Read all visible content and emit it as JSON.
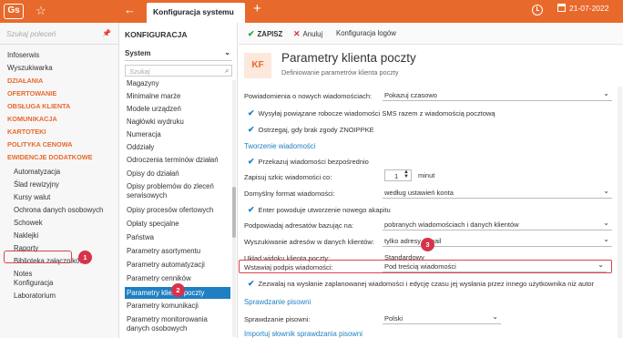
{
  "topbar": {
    "logo": "Gs",
    "tab_title": "Konfiguracja systemu",
    "date": "21-07-2022",
    "accent": "#e8692c"
  },
  "left_nav": {
    "search_placeholder": "Szukaj poleceń",
    "items": [
      {
        "label": "Infoserwis",
        "type": "plain"
      },
      {
        "label": "Wyszukiwarka",
        "type": "plain"
      },
      {
        "label": "DZIAŁANIA",
        "type": "group"
      },
      {
        "label": "OFERTOWANIE",
        "type": "group"
      },
      {
        "label": "OBSŁUGA KLIENTA",
        "type": "group"
      },
      {
        "label": "KOMUNIKACJA",
        "type": "group"
      },
      {
        "label": "KARTOTEKI",
        "type": "group"
      },
      {
        "label": "POLITYKA CENOWA",
        "type": "group"
      },
      {
        "label": "EWIDENCJE DODATKOWE",
        "type": "group"
      },
      {
        "label": "Automatyzacja",
        "type": "sub"
      },
      {
        "label": "Ślad rewizyjny",
        "type": "sub"
      },
      {
        "label": "Kursy walut",
        "type": "sub"
      },
      {
        "label": "Ochrona danych osobowych",
        "type": "sub"
      },
      {
        "label": "Schowek",
        "type": "sub"
      },
      {
        "label": "Naklejki",
        "type": "sub"
      },
      {
        "label": "Raporty",
        "type": "sub"
      },
      {
        "label": "Biblioteka załączników",
        "type": "sub"
      },
      {
        "label": "Notes",
        "type": "sub"
      },
      {
        "label": "Konfiguracja",
        "type": "sub"
      },
      {
        "label": "Laboratorium",
        "type": "sub"
      }
    ]
  },
  "middle": {
    "title": "KONFIGURACJA",
    "select_value": "System",
    "search_placeholder": "Szukaj",
    "items": [
      "Magazyny",
      "Minimalne marże",
      "Modele urządzeń",
      "Nagłówki wydruku",
      "Numeracja",
      "Oddziały",
      "Odroczenia terminów działań",
      "Opisy do działań",
      "Opisy problemów do zleceń serwisowych",
      "Opisy procesów ofertowych",
      "Opłaty specjalne",
      "Państwa",
      "Parametry asortymentu",
      "Parametry automatyzacji",
      "Parametry cenników",
      "Parametry działań",
      "Parametry klienta poczty",
      "Parametry komunikacji",
      "Parametry monitorowania danych osobowych"
    ]
  },
  "toolbar": {
    "save": "ZAPISZ",
    "cancel": "Anuluj",
    "logs": "Konfiguracja logów"
  },
  "page": {
    "icon_text": "KF",
    "title": "Parametry klienta poczty",
    "subtitle": "Definiowanie parametrów klienta poczty"
  },
  "form": {
    "notify_label": "Powiadomienia o nowych wiadomościach:",
    "notify_value": "Pokazuj czasowo",
    "check_sms": "Wysyłaj powiązane robocze wiadomości SMS razem z wiadomością pocztową",
    "check_warn": "Ostrzegaj, gdy brak zgody ZNOIPPKE",
    "section_create": "Tworzenie wiadomości",
    "check_forward": "Przekazuj wiadomości bezpośrednio",
    "draft_label": "Zapisuj szkic wiadomości co:",
    "draft_value": "1",
    "draft_unit": "minut",
    "format_label": "Domyślny format wiadomości:",
    "format_value": "według ustawień konta",
    "check_enter": "Enter powoduje utworzenie nowego akapitu",
    "suggest_label": "Podpowiadaj adresatów bazując na:",
    "suggest_value": "pobranych wiadomościach i danych klientów",
    "search_label": "Wyszukiwanie adresów w danych klientów:",
    "search_value": "tylko adresy e-mail",
    "layout_label": "Układ widoku klienta poczty:",
    "layout_value": "Standardowy",
    "signature_label": "Wstawiaj podpis wiadomości:",
    "signature_value": "Pod treścią wiadomości",
    "check_allow": "Zezwalaj na wysłanie zaplanowanej wiadomości i edycję czasu jej wysłania przez innego użytkownika niż autor",
    "section_spell": "Sprawdzanie pisowni",
    "spell_label": "Sprawdzanie pisowni:",
    "spell_value": "Polski",
    "section_import": "Importuj słownik sprawdzania pisowni"
  },
  "badges": [
    "1",
    "2",
    "3"
  ]
}
